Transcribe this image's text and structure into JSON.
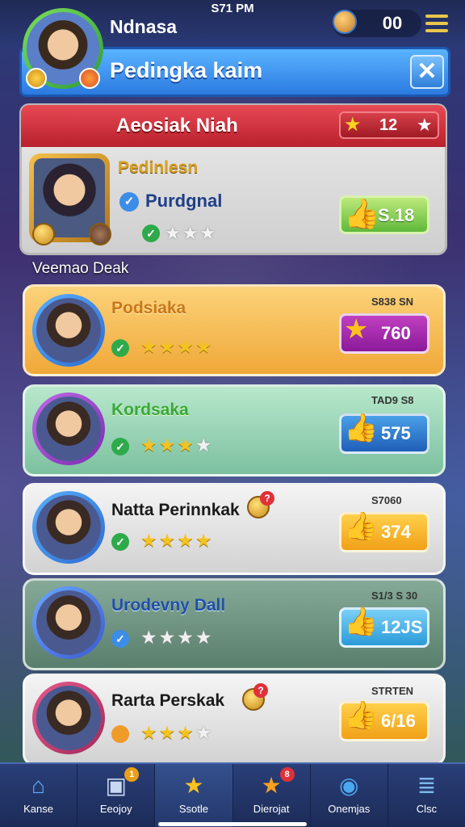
{
  "status": {
    "time": "S71 PM"
  },
  "header": {
    "player_name": "Ndnasa",
    "coins": "00",
    "title": "Pedingka kaim",
    "close_glyph": "✕"
  },
  "panel": {
    "title": "Aeosiak Niah",
    "pill_value": "12",
    "featured": {
      "name": "Pedinlesn",
      "subtitle": "Purdgnal",
      "stars": "★★★",
      "score": "S.18"
    }
  },
  "section_label": "Veemao Deak",
  "cards": [
    {
      "name": "Podsiaka",
      "small": "S838 SN",
      "score": "760",
      "stars_on": "★★★★",
      "stars_off": "",
      "accent": "#f3b54a"
    },
    {
      "name": "Kordsaka",
      "small": "TAD9 S8",
      "score": "575",
      "stars_on": "★★★",
      "stars_off": "★",
      "accent": "#8fcfb0"
    },
    {
      "name": "Natta Perinnkak",
      "small": "S7060",
      "score": "374",
      "stars_on": "★★★★",
      "stars_off": "",
      "accent": "#e6e6e6"
    },
    {
      "name": "Urodevny Dall",
      "small": "S1/3 S 30",
      "score": "12JS",
      "stars_on": "",
      "stars_off": "★★★★",
      "accent": "#6f9a86"
    },
    {
      "name": "Rarta Perskak",
      "small": "STRTEN",
      "score": "6/16",
      "stars_on": "★★★",
      "stars_off": "★",
      "accent": "#e6e6e6"
    }
  ],
  "nav": [
    {
      "label": "Kanse",
      "icon": "home-icon",
      "glyph": "⌂"
    },
    {
      "label": "Eeojoy",
      "icon": "card-icon",
      "glyph": "▣",
      "badge": "1"
    },
    {
      "label": "Ssotle",
      "icon": "star-icon",
      "glyph": "★"
    },
    {
      "label": "Dierojat",
      "icon": "star-badge-icon",
      "glyph": "★",
      "badge": "8"
    },
    {
      "label": "Onemjas",
      "icon": "globe-icon",
      "glyph": "◉"
    },
    {
      "label": "Clsc",
      "icon": "stack-icon",
      "glyph": "≣"
    }
  ]
}
